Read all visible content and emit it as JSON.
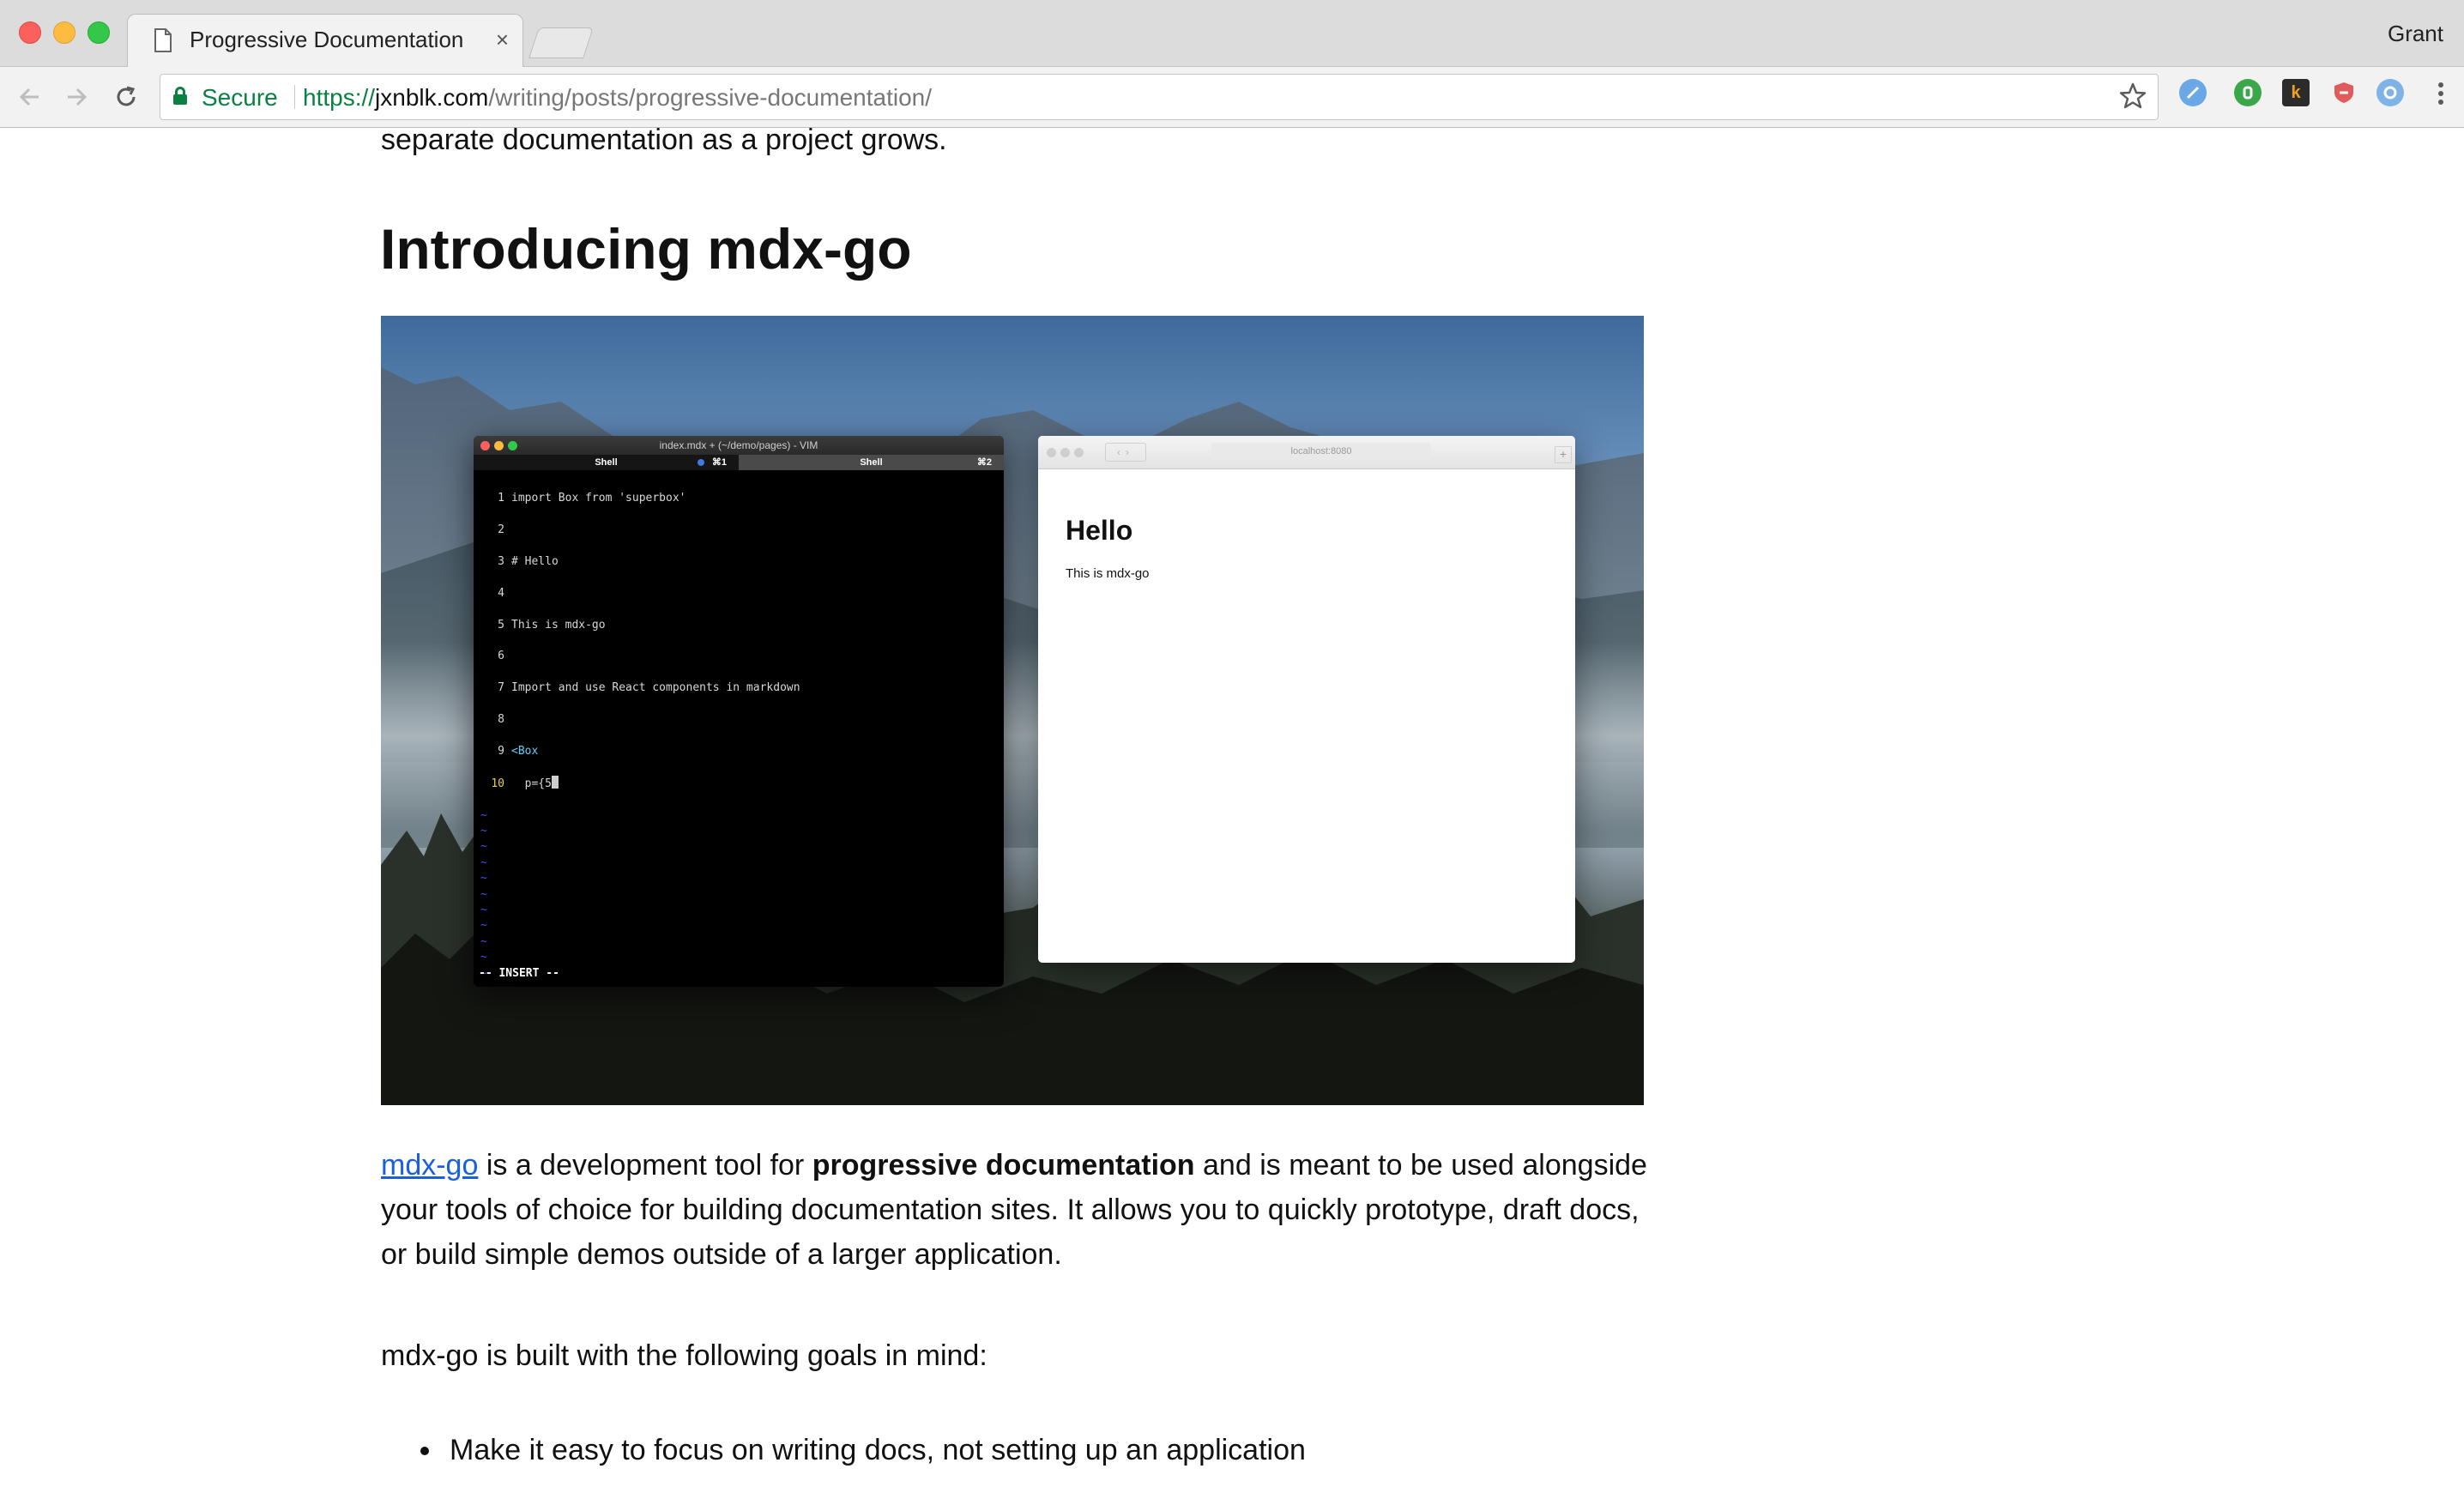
{
  "browser": {
    "tab_title": "Progressive Documentation",
    "tab_close": "×",
    "profile_name": "Grant",
    "secure_label": "Secure",
    "url_scheme": "https://",
    "url_host": "jxnblk.com",
    "url_path": "/writing/posts/progressive-documentation/"
  },
  "article": {
    "intro_fragment": "separate documentation as a project grows.",
    "heading": "Introducing mdx-go",
    "para1": {
      "link_text": "mdx-go",
      "text_a": " is a development tool for ",
      "bold_text": "progressive documentation",
      "text_b": " and is meant to be used alongside your tools of choice for building documentation sites. It allows you to quickly prototype, draft docs, or build simple demos outside of a larger application."
    },
    "para2": "mdx-go is built with the following goals in mind:",
    "bullets": [
      "Make it easy to focus on writing docs, not setting up an application"
    ]
  },
  "screenshot": {
    "terminal": {
      "title": "index.mdx + (~/demo/pages) - VIM",
      "tab1": "Shell",
      "tab1_shortcut": "⌘1",
      "tab2": "Shell",
      "tab2_shortcut": "⌘2",
      "lines": [
        {
          "n": "1",
          "text": "import Box from 'superbox'"
        },
        {
          "n": "2",
          "text": ""
        },
        {
          "n": "3",
          "text": "# Hello"
        },
        {
          "n": "4",
          "text": ""
        },
        {
          "n": "5",
          "text": "This is mdx-go"
        },
        {
          "n": "6",
          "text": ""
        },
        {
          "n": "7",
          "text": "Import and use React components in markdown"
        },
        {
          "n": "8",
          "text": ""
        },
        {
          "n": "9",
          "text": "<Box"
        },
        {
          "n": "10",
          "text": "  p={5"
        }
      ],
      "mode": "-- INSERT --"
    },
    "preview": {
      "url": "localhost:8080",
      "heading": "Hello",
      "body": "This is mdx-go"
    }
  },
  "colors": {
    "link": "#1a5fdc",
    "secure_green": "#0b8043"
  }
}
